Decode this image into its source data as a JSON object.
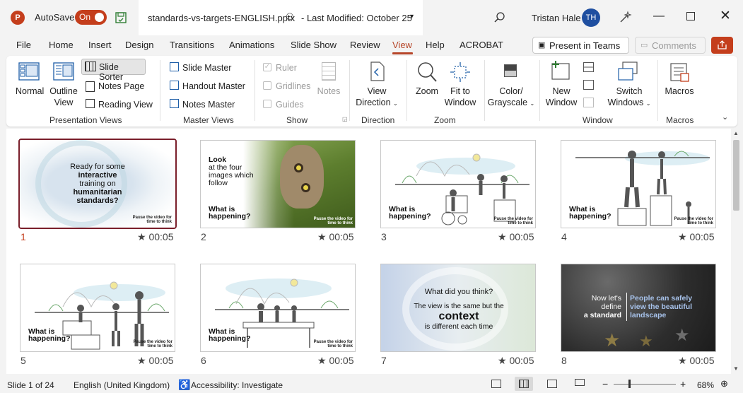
{
  "titlebar": {
    "app_letter": "P",
    "autosave_label": "AutoSave",
    "autosave_state": "On",
    "filename": "standards-vs-targets-ENGLISH.pptx",
    "last_modified": "- Last Modified: October 25",
    "user_name": "Tristan Hale",
    "user_initials": "TH"
  },
  "menu": {
    "items": [
      "File",
      "Home",
      "Insert",
      "Design",
      "Transitions",
      "Animations",
      "Slide Show",
      "Review",
      "View",
      "Help",
      "ACROBAT"
    ],
    "active": "View",
    "present_teams": "Present in Teams",
    "comments": "Comments"
  },
  "ribbon": {
    "groups": {
      "presentation_views": "Presentation Views",
      "master_views": "Master Views",
      "show": "Show",
      "direction": "Direction",
      "zoom": "Zoom",
      "window": "Window",
      "macros": "Macros"
    },
    "normal": "Normal",
    "outline_view": [
      "Outline",
      "View"
    ],
    "slide_sorter": "Slide Sorter",
    "notes_page": "Notes Page",
    "reading_view": "Reading View",
    "slide_master": "Slide Master",
    "handout_master": "Handout Master",
    "notes_master": "Notes Master",
    "ruler": "Ruler",
    "gridlines": "Gridlines",
    "guides": "Guides",
    "notes": "Notes",
    "view_direction": [
      "View",
      "Direction"
    ],
    "zoom": "Zoom",
    "fit_to_window": [
      "Fit to",
      "Window"
    ],
    "color_grayscale": [
      "Color/",
      "Grayscale"
    ],
    "new_window": [
      "New",
      "Window"
    ],
    "switch_windows": [
      "Switch",
      "Windows"
    ],
    "macros": "Macros"
  },
  "slides": [
    {
      "num": "1",
      "dur": "00:05",
      "lines": [
        "Ready for some",
        "interactive",
        "training on",
        "humanitarian",
        "standards?"
      ],
      "footer": [
        "Pause the video for",
        "time to think"
      ]
    },
    {
      "num": "2",
      "dur": "00:05",
      "lines": [
        "Look",
        "at the four",
        "images which",
        "follow"
      ],
      "q": [
        "What is",
        "happening?"
      ],
      "footer": [
        "Pause the video for",
        "time to think"
      ]
    },
    {
      "num": "3",
      "dur": "00:05",
      "q": [
        "What is",
        "happening?"
      ],
      "footer": [
        "Pause the video for",
        "time to think"
      ]
    },
    {
      "num": "4",
      "dur": "00:05",
      "q": [
        "What is",
        "happening?"
      ],
      "footer": [
        "Pause the video for",
        "time to think"
      ]
    },
    {
      "num": "5",
      "dur": "00:05",
      "q": [
        "What is",
        "happening?"
      ],
      "footer": [
        "Pause the video for",
        "time to think"
      ]
    },
    {
      "num": "6",
      "dur": "00:05",
      "q": [
        "What is",
        "happening?"
      ],
      "footer": [
        "Pause the video for",
        "time to think"
      ]
    },
    {
      "num": "7",
      "dur": "00:05",
      "lines": [
        "What did you think?",
        "The view is the same but the",
        "context",
        "is different each time"
      ]
    },
    {
      "num": "8",
      "dur": "00:05",
      "lines": [
        "Now let's",
        "define",
        "a standard",
        "People can safely",
        "view the beautiful",
        "landscape"
      ]
    }
  ],
  "status": {
    "slide_of": "Slide 1 of 24",
    "language": "English (United Kingdom)",
    "accessibility": "Accessibility: Investigate",
    "zoom": "68%"
  },
  "colors": {
    "accent": "#c43e1c",
    "selected_border": "#7a1f2b",
    "active_tab": "#b7472a"
  }
}
